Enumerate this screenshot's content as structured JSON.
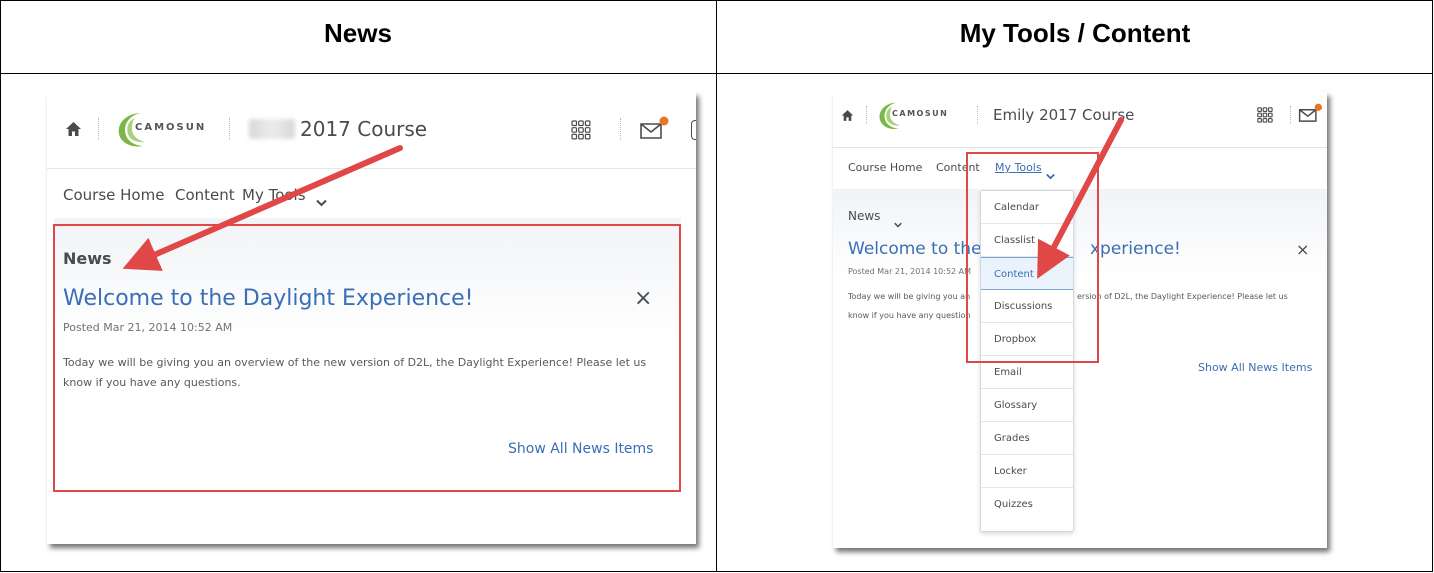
{
  "columns": {
    "left_title": "News",
    "right_title": "My Tools / Content"
  },
  "left": {
    "logo_text": "CAMOSUN",
    "course_title": "2017 Course",
    "subnav": [
      "Course Home",
      "Content",
      "My Tools"
    ],
    "news_heading": "News",
    "news_title": "Welcome to the Daylight Experience!",
    "posted": "Posted Mar 21, 2014 10:52 AM",
    "body": "Today we will be giving you an overview of the new version of D2L, the Daylight Experience!  Please let us know if you have any questions.",
    "show_all": "Show All News Items",
    "close": "×"
  },
  "right": {
    "logo_text": "CAMOSUN",
    "course_title": "Emily 2017 Course",
    "subnav": [
      "Course Home",
      "Content",
      "My Tools"
    ],
    "news_heading": "News",
    "news_title_left": "Welcome to the",
    "news_title_right": "xperience!",
    "posted": "Posted Mar 21, 2014 10:52 AM",
    "body_line1_left": "Today we will be giving you an",
    "body_line1_right": "ersion of D2L, the Daylight Experience!  Please let us",
    "body_line2_left": "know if you have any question",
    "show_all": "Show All News Items",
    "close": "×",
    "dropdown_items": [
      "Calendar",
      "Classlist",
      "Content",
      "Discussions",
      "Dropbox",
      "Email",
      "Glossary",
      "Grades",
      "Locker",
      "Quizzes"
    ],
    "selected_item": "Content"
  },
  "colors": {
    "link_blue": "#3a6eb5",
    "annotation_red": "#e04848",
    "notification_orange": "#e87722",
    "logo_green": "#7ab648"
  }
}
